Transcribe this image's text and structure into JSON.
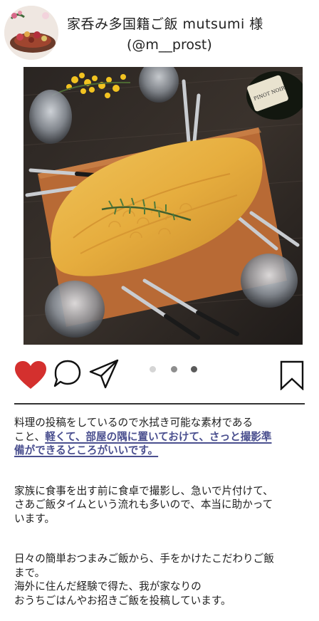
{
  "post_header": {
    "user_name": "家呑み多国籍ご飯 mutsumi 様",
    "user_handle": "(@m__prost)"
  },
  "post_photo": {
    "bottle_label": "PINOT NOIR"
  },
  "actions": {
    "like_icon": "heart-filled-icon",
    "comment_icon": "speech-bubble-icon",
    "share_icon": "paper-plane-icon",
    "bookmark_icon": "bookmark-icon",
    "like_color": "#d4302e",
    "carousel_dots": 3,
    "carousel_active_index": 0
  },
  "caption": {
    "line_1": "料理の投稿をしているので水拭き可能な素材である",
    "line_2_plain": "こと、",
    "line_2_highlight": "軽くて、部屋の隅に置いておけて、さっと撮影準",
    "line_3_highlight": "備ができるところがいいです。",
    "para_2_lines": [
      "家族に食事を出す前に食卓で撮影し、急いで片付けて、",
      "さあご飯タイムという流れも多いので、本当に助かって",
      "います。"
    ],
    "para_3_lines": [
      "日々の簡単おつまみご飯から、手をかけたこだわりご飯",
      "まで。",
      "海外に住んだ経験で得た、我が家なりの",
      "おうちごはんやお招きご飯を投稿しています。"
    ],
    "highlight_color": "#4a4f8f"
  }
}
